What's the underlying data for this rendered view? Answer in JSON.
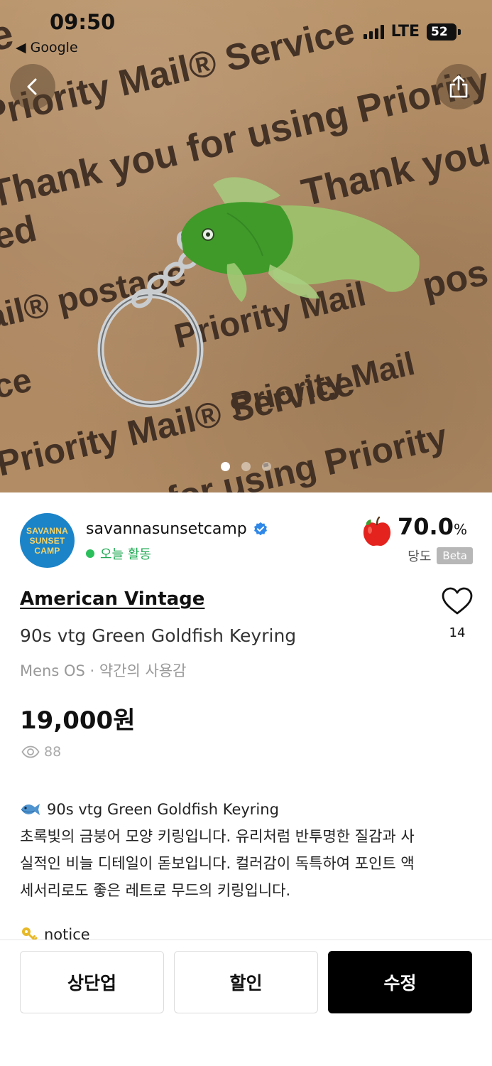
{
  "status_bar": {
    "time": "09:50",
    "back_app": "◀ Google",
    "network": "LTE",
    "battery": "52"
  },
  "photo": {
    "box_text": {
      "line1": "Priority Mail® Service",
      "line2": "Thank you for using Priority",
      "line3": "Thank you",
      "line4": "ed",
      "line5": "ail® postage",
      "line6": "Priority Mail",
      "line7": "pos",
      "line8": "ce",
      "line9": "Priority Mail® Service",
      "line10": "Priority Mail® Service",
      "line11": "Priority Mail",
      "line12": "for using Priority",
      "line13": "e"
    },
    "page_indicator": {
      "total": 3,
      "current": 1
    }
  },
  "seller": {
    "logo_line1": "SAVANNA",
    "logo_line2": "SUNSET",
    "logo_line3": "CAMP",
    "name": "savannasunsetcamp",
    "activity": "오늘 활동",
    "sweetness_value": "70.0",
    "sweetness_unit": "%",
    "sweetness_label": "당도",
    "beta": "Beta"
  },
  "product": {
    "brand": "American Vintage",
    "title": "90s vtg Green Goldfish Keyring",
    "meta": "Mens OS · 약간의 사용감",
    "price": "19,000원",
    "views": "88",
    "likes": "14"
  },
  "description": {
    "heading": "90s vtg Green Goldfish Keyring",
    "line1": "초록빛의 금붕어 모양 키링입니다. 유리처럼 반투명한 질감과 사",
    "line2": "실적인 비늘 디테일이 돋보입니다. 컬러감이 독특하여 포인트 액",
    "line3": "세서리로도 좋은 레트로 무드의 키링입니다.",
    "notice": "notice"
  },
  "actions": {
    "bump": "상단업",
    "discount": "할인",
    "edit": "수정"
  },
  "colors": {
    "accent_black": "#000000",
    "activity_green": "#2bbf5c",
    "verified_blue": "#2f88e8",
    "apple_red": "#e4231e"
  }
}
